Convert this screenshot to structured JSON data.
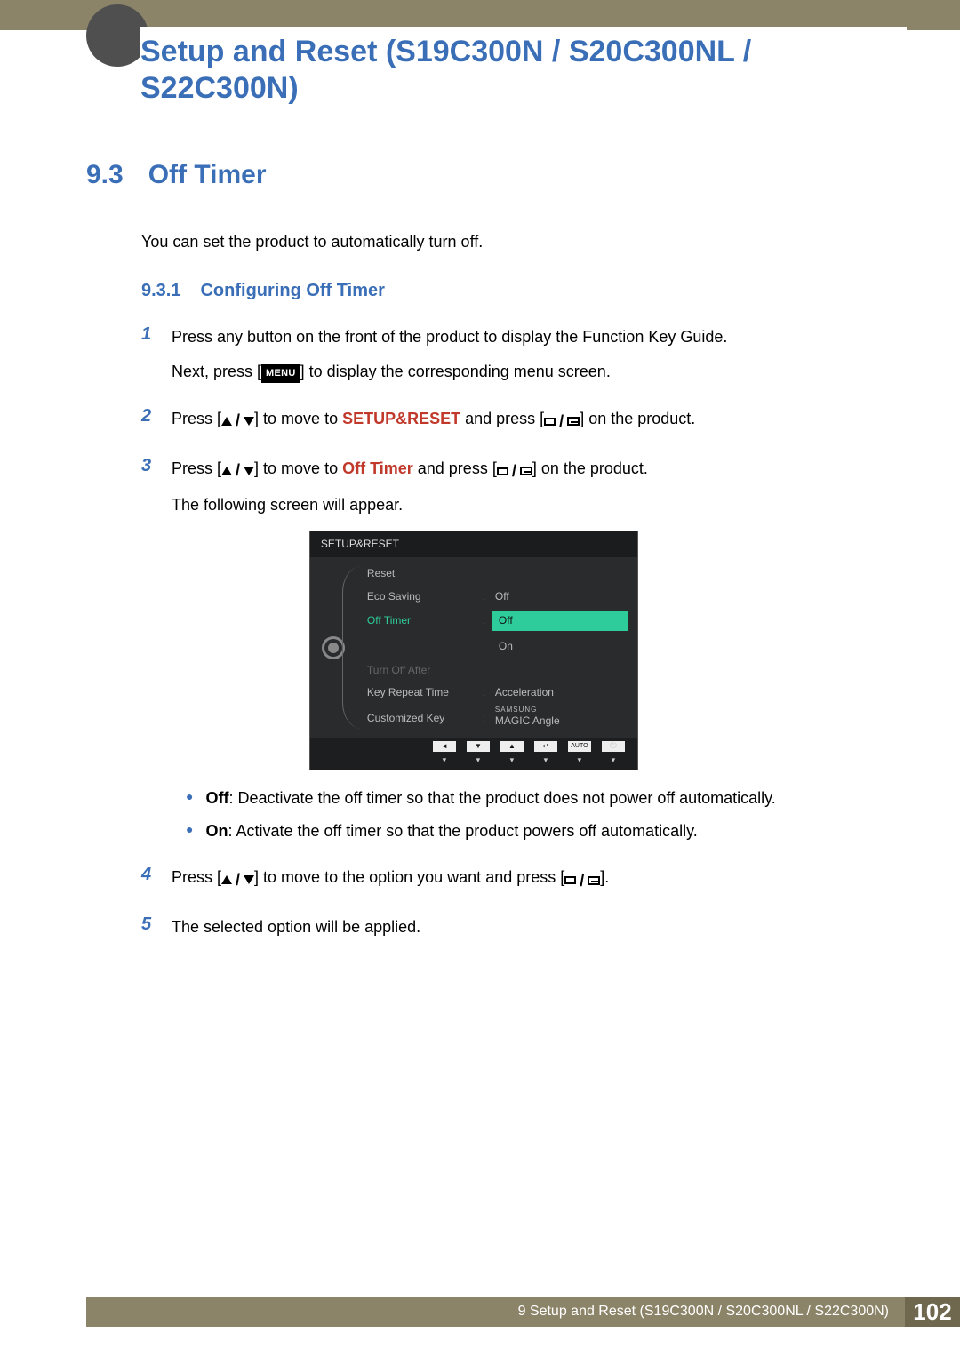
{
  "chapter_title": "Setup and Reset (S19C300N / S20C300NL / S22C300N)",
  "section": {
    "num": "9.3",
    "title": "Off Timer"
  },
  "intro": "You can set the product to automatically turn off.",
  "subsection": {
    "num": "9.3.1",
    "title": "Configuring Off Timer"
  },
  "steps": {
    "s1": {
      "num": "1",
      "p1": "Press any button on the front of the product to display the Function Key Guide.",
      "p2a": "Next, press [",
      "menu": "MENU",
      "p2b": "] to display the corresponding menu screen."
    },
    "s2": {
      "num": "2",
      "a": "Press [",
      "b": "] to move to ",
      "target": "SETUP&RESET",
      "c": " and press [",
      "d": "] on the product."
    },
    "s3": {
      "num": "3",
      "a": "Press [",
      "b": "] to move to ",
      "target": "Off Timer",
      "c": " and press [",
      "d": "] on the product.",
      "p2": "The following screen will appear."
    },
    "s4": {
      "num": "4",
      "a": "Press [",
      "b": "] to move to the option you want and press [",
      "c": "]."
    },
    "s5": {
      "num": "5",
      "text": "The selected option will be applied."
    }
  },
  "bullets": {
    "off_label": "Off",
    "off_text": ": Deactivate the off timer so that the product does not power off automatically.",
    "on_label": "On",
    "on_text": ": Activate the off timer so that the product powers off automatically."
  },
  "osd": {
    "title": "SETUP&RESET",
    "rows": {
      "reset": "Reset",
      "eco": "Eco Saving",
      "eco_v": "Off",
      "off_timer": "Off Timer",
      "off_timer_v": "Off",
      "off_timer_v2": "On",
      "turn_off": "Turn Off After",
      "key_repeat": "Key Repeat Time",
      "key_repeat_v": "Acceleration",
      "custom": "Customized Key",
      "custom_brand": "SAMSUNG",
      "custom_v": "MAGIC",
      "custom_v2": "Angle"
    },
    "nav": {
      "auto": "AUTO"
    }
  },
  "footer": {
    "text": "9 Setup and Reset (S19C300N / S20C300NL / S22C300N)",
    "page": "102"
  }
}
